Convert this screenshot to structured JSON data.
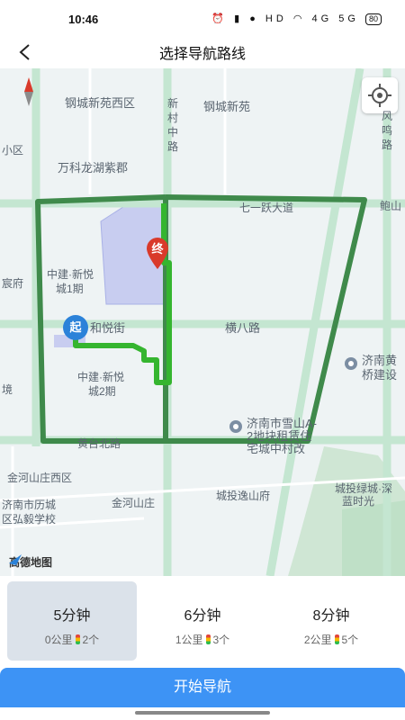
{
  "status_bar": {
    "time": "10:46",
    "icons": "⏰ ▮ ● HD ◠ 4G 5G",
    "battery": "80"
  },
  "header": {
    "title": "选择导航路线"
  },
  "map": {
    "labels": [
      "钢城新苑西区",
      "钢城新苑",
      "新",
      "村",
      "中",
      "路",
      "风",
      "鸣",
      "路",
      "小区",
      "万科龙湖紫郡",
      "七一跃大道",
      "鲍山",
      "中建·新悦",
      "城1期",
      "宸府",
      "和悦街",
      "横八路",
      "济南黄",
      "桥建设",
      "中建·新悦",
      "城2期",
      "境",
      "济南市雪山A-",
      "2地块租赁住",
      "宅城中村改",
      "黄台北路",
      "金河山庄西区",
      "济南市历城",
      "区弘毅学校",
      "金河山庄",
      "城投逸山府",
      "城投绿城·深",
      "蓝时光"
    ],
    "markers": {
      "start": "起",
      "end": "终"
    },
    "logo": "高德地图",
    "colors": {
      "route_selected": "#35b52f",
      "route_alt": "#3f8a4b",
      "start_marker": "#2b82d9",
      "end_marker": "#d93a2b"
    }
  },
  "routes": [
    {
      "time": "5分钟",
      "distance": "0公里",
      "lights": "2个",
      "selected": true
    },
    {
      "time": "6分钟",
      "distance": "1公里",
      "lights": "3个",
      "selected": false
    },
    {
      "time": "8分钟",
      "distance": "2公里",
      "lights": "5个",
      "selected": false
    }
  ],
  "actions": {
    "start_navigation": "开始导航"
  }
}
